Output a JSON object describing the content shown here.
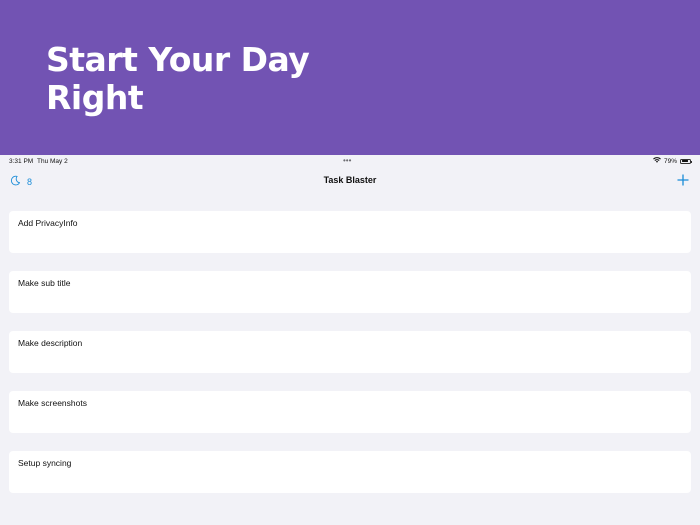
{
  "promo": {
    "headline": "Start Your Day Right",
    "background_color": "#7253b3"
  },
  "status_bar": {
    "time": "3:31 PM",
    "date": "Thu May 2",
    "multitask_indicator": "•••",
    "wifi_icon": "wifi-icon",
    "battery_percent": "79%",
    "battery_level": 0.79
  },
  "nav": {
    "title": "Task Blaster",
    "moon_icon": "moon-icon",
    "moon_count": "8",
    "add_icon": "plus-icon",
    "accent_color": "#1a8cd8"
  },
  "tasks": [
    {
      "title": "Add PrivacyInfo"
    },
    {
      "title": "Make sub title"
    },
    {
      "title": "Make description"
    },
    {
      "title": "Make screenshots"
    },
    {
      "title": "Setup syncing"
    }
  ]
}
